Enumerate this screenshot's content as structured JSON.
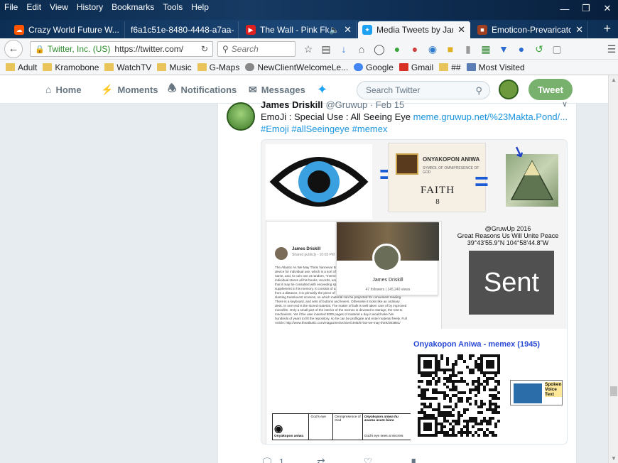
{
  "menu": [
    "File",
    "Edit",
    "View",
    "History",
    "Bookmarks",
    "Tools",
    "Help"
  ],
  "tabs": [
    {
      "label": "Crazy World Future W...",
      "color": "#ff5500"
    },
    {
      "label": "f6a1c51e-8480-4448-a7aa-...",
      "color": "#888888"
    },
    {
      "label": "The Wall - Pink Flo...",
      "color": "#e02020"
    },
    {
      "label": "Media Tweets by Jame...",
      "color": "#1da1f2"
    },
    {
      "label": "Emoticon-Prevaricator...",
      "color": "#a04020"
    }
  ],
  "address": {
    "owner": "Twitter, Inc. (US)",
    "url": "https://twitter.com/"
  },
  "search": {
    "placeholder": "Search"
  },
  "bookmarks": [
    "Adult",
    "Kramobone",
    "WatchTV",
    "Music",
    "G-Maps",
    "NewClientWelcomeLe...",
    "Google",
    "Gmail",
    "##",
    "Most Visited"
  ],
  "twitter_nav": {
    "home": "Home",
    "moments": "Moments",
    "notifications": "Notifications",
    "messages": "Messages",
    "search_placeholder": "Search Twitter",
    "tweet_button": "Tweet"
  },
  "tweet": {
    "name": "James Driskill",
    "handle": "@Gruwup · Feb 15",
    "text_prefix": "EmoJi : Special Use : All Seeing Eye ",
    "link": "meme.gruwup.net/%23Makta.Pond/...",
    "hashtags": "#Emoji #allSeeingeye #memex",
    "replies": "1"
  },
  "media": {
    "faith_title": "ONYAKOPON ANIWA",
    "faith_sub": "SYMBOL OF OMNIPRESENCE OF GOD",
    "faith_word": "FAITH",
    "faith_num": "8",
    "growup_line1": "@GruwUp 2016",
    "growup_line2": "Great Reasons Us Will Unite Peace",
    "growup_line3": "39°43'55.9\"N 104°58'44.8\"W",
    "sent": "Sent",
    "memex_title": "Onyakopon Aniwa - memex (1945)",
    "voice_text": "Spoken Voice Text",
    "post_name": "James Driskill",
    "post_sub": "Shared publicly - 10:03 PM",
    "post_body": "The Atlantic As We May Think Vannevar Bush July 1945 Issue Excerpt: Consider a future device for individual use, which is a sort of mechanized private file and library. It needs a name, and, to coin one at random, \"memex\" will do. A memex is a device in which an individual stores all his books, records, and communications, and which is mechanized so that it may be consulted with exceeding speed and flexibility. It is an enlarged intimate supplement to his memory. It consists of a desk, and while it can presumably be operated from a distance, it is primarily the piece of furniture at which he works. On the top are slanting translucent screens, on which material can be projected for convenient reading. There is a keyboard, and sets of buttons and levers. Otherwise it looks like an ordinary desk. In one end is the stored material. The matter of bulk is well taken care of by improved microfilm. Only a small part of the interior of the memex is devoted to storage, the rest to mechanism. Yet if the user inserted 5000 pages of material a day it would take him hundreds of years to fill the repository, so he can be profligate and enter material freely. Full Article: http://www.theatlantic.com/magazine/archive/1945/07/as-we-may-think/303881/",
    "profile_name": "James Driskill",
    "profile_stats": "47 followers  |  145,240 views",
    "table_col1": "Onyakopon aniwa",
    "table_col2": "God's eye",
    "table_col3": "Omnipresence of God",
    "table_col4_top": "Onyakopon aniwa hu asumu asem biara",
    "table_col4_bottom": "God's eye sees al secrets"
  }
}
